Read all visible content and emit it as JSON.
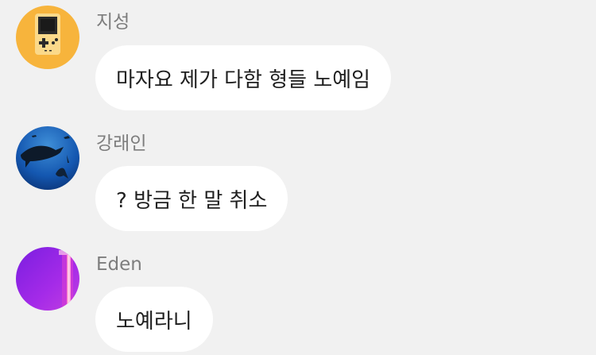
{
  "messages": [
    {
      "sender": "지성",
      "text": "마자요 제가 다함 형들 노예임",
      "avatar": "gameboy-avatar"
    },
    {
      "sender": "강래인",
      "text": "? 방금 한 말 취소",
      "avatar": "shark-avatar"
    },
    {
      "sender": "Eden",
      "text": "노예라니",
      "avatar": "purple-light-avatar"
    }
  ],
  "colors": {
    "background": "#f1f1f1",
    "bubble": "#ffffff",
    "sender_text": "#7d7d7d",
    "message_text": "#1f1f1f"
  }
}
